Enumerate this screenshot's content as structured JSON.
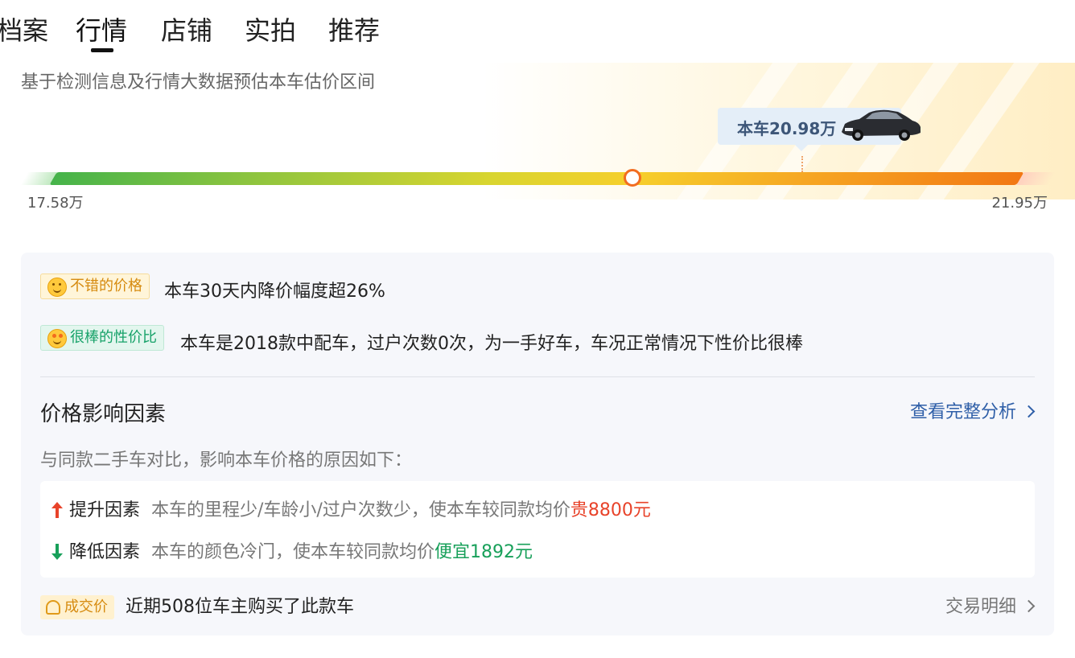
{
  "tabs": [
    {
      "label": "档案"
    },
    {
      "label": "行情"
    },
    {
      "label": "店铺"
    },
    {
      "label": "实拍"
    },
    {
      "label": "推荐"
    }
  ],
  "active_tab": "行情",
  "estimate": {
    "subtitle": "基于检测信息及行情大数据预估本车估价区间",
    "car_price_label": "本车20.98万",
    "min_label": "17.58万",
    "max_label": "21.95万",
    "min_value": 17.58,
    "max_value": 21.95,
    "car_value": 20.98
  },
  "badges": [
    {
      "label": "不错的价格",
      "text": "本车30天内降价幅度超26%"
    },
    {
      "label": "很棒的性价比",
      "text": "本车是2018款中配车，过户次数0次，为一手好车，车况正常情况下性价比很棒"
    }
  ],
  "factors_section": {
    "title": "价格影响因素",
    "link": "查看完整分析",
    "desc": "与同款二手车对比，影响本车价格的原因如下："
  },
  "factors": [
    {
      "label": "提升因素",
      "desc": "本车的里程少/车龄小/过户次数少，使本车较同款均价",
      "highlight": "贵8800元"
    },
    {
      "label": "降低因素",
      "desc": "本车的颜色冷门，使本车较同款均价",
      "highlight": "便宜1892元"
    }
  ],
  "deal": {
    "badge": "成交价",
    "text": "近期508位车主购买了此款车",
    "link": "交易明细"
  },
  "colors": {
    "link_blue": "#2f5fa8",
    "up_red": "#e8432a",
    "down_green": "#18a05a",
    "accent_orange": "#f26d21"
  }
}
